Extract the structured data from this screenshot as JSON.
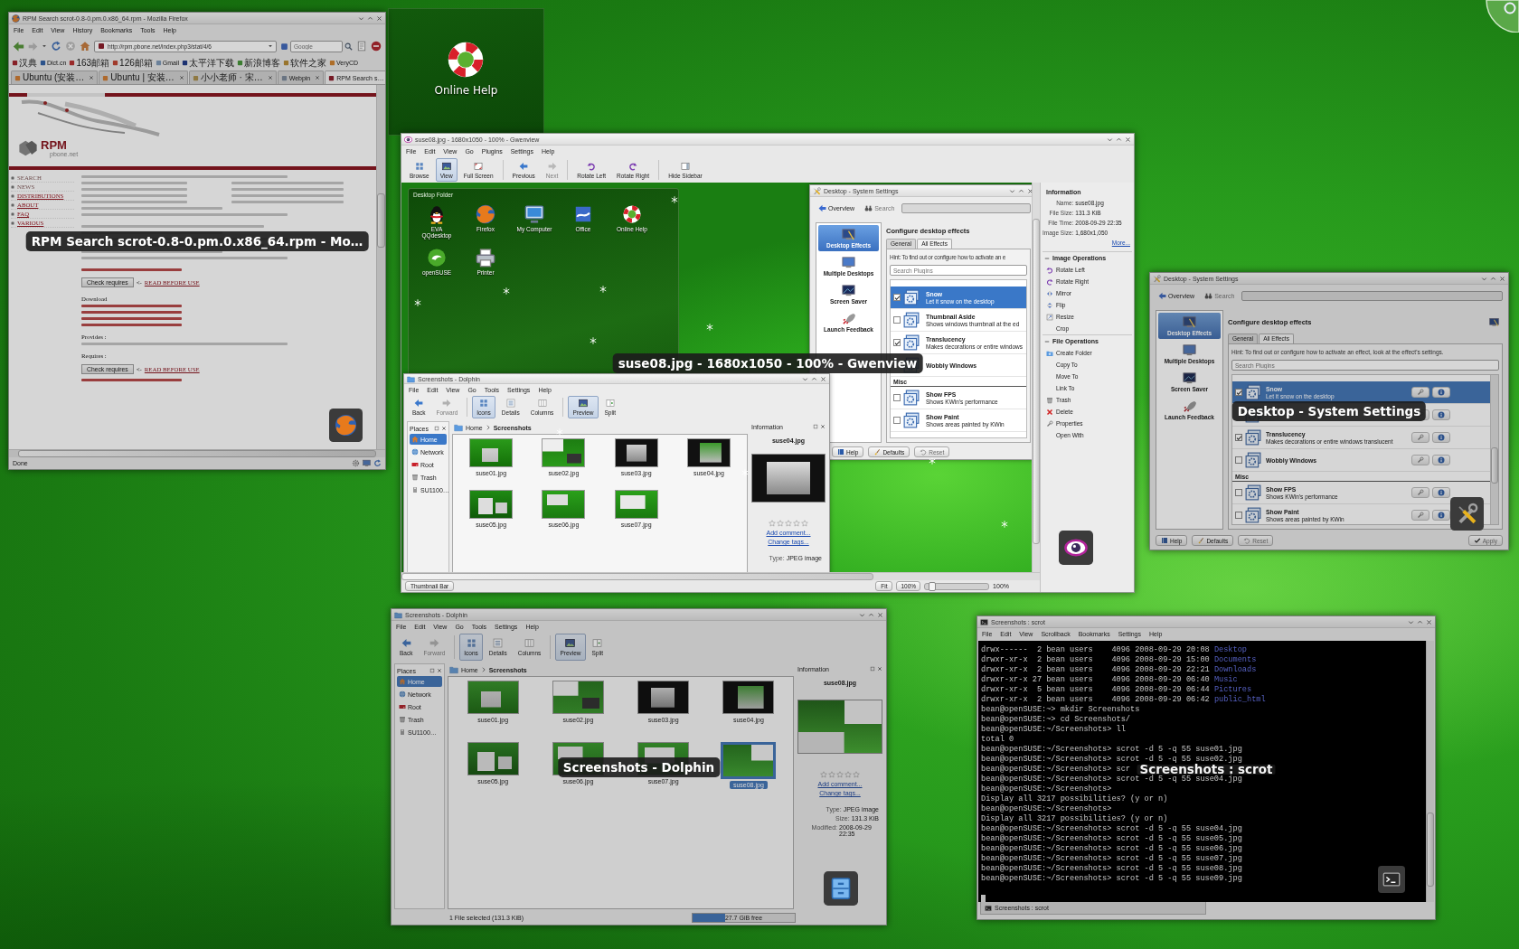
{
  "firefox": {
    "highlighted": false,
    "caption": "RPM Search scrot-0.8-0.pm.0.x86_64.rpm - Mo…",
    "title": "RPM Search scrot-0.8-0.pm.0.x86_64.rpm - Mozilla Firefox",
    "menu": [
      "File",
      "Edit",
      "View",
      "History",
      "Bookmarks",
      "Tools",
      "Help"
    ],
    "url": "http://rpm.pbone.net/index.php3/stat/4/6",
    "search_placeholder": "Google",
    "bookmarks": [
      "汉典",
      "Dict.cn",
      "163邮箱",
      "126邮箱",
      "Gmail",
      "太平洋下载",
      "新浪博客",
      "软件之家",
      "VeryCD"
    ],
    "tabs": [
      {
        "label": "Ubuntu (安装…",
        "selected": false
      },
      {
        "label": "Ubuntu | 安装…",
        "selected": false
      },
      {
        "label": "小小老师 · 宋…",
        "selected": false
      },
      {
        "label": "Webpin",
        "selected": false
      },
      {
        "label": "RPM Search s…",
        "selected": true
      }
    ],
    "page": {
      "logo": "RPM",
      "logo_sub": "pbone.net",
      "site_menu": [
        {
          "label": "SEARCH",
          "link": false
        },
        {
          "label": "NEWS",
          "link": false
        },
        {
          "label": "DISTRIBUTIONS",
          "link": true
        },
        {
          "label": "ABOUT",
          "link": true
        },
        {
          "label": "FAQ",
          "link": true
        },
        {
          "label": "VARIOUS",
          "link": true
        }
      ],
      "blocks": [
        {
          "kind": "line"
        },
        {
          "kind": "pair"
        },
        {
          "kind": "pair"
        },
        {
          "kind": "pair"
        },
        {
          "kind": "pair"
        },
        {
          "kind": "line"
        },
        {
          "kind": "line"
        },
        {
          "kind": "line"
        },
        {
          "kind": "line"
        },
        {
          "kind": "line"
        },
        {
          "kind": "line"
        },
        {
          "kind": "line"
        },
        {
          "kind": "line"
        },
        {
          "kind": "link"
        },
        {
          "kind": "button",
          "label": "Check requires",
          "pointer": "<-",
          "link": "READ BEFORE USE"
        },
        {
          "kind": "heading",
          "text": "Download"
        },
        {
          "kind": "link"
        },
        {
          "kind": "link"
        },
        {
          "kind": "link"
        },
        {
          "kind": "link"
        },
        {
          "kind": "heading",
          "text": "Provides :"
        },
        {
          "kind": "line"
        },
        {
          "kind": "heading",
          "text": "Requires :"
        },
        {
          "kind": "button",
          "label": "Check requires",
          "pointer": "<-",
          "link": "READ BEFORE USE"
        },
        {
          "kind": "link"
        }
      ]
    },
    "status": "Done"
  },
  "desktop": {
    "widget_label": "Online Help"
  },
  "gwenview": {
    "highlighted": true,
    "caption": "suse08.jpg - 1680x1050 - 100% - Gwenview",
    "title": "suse08.jpg - 1680x1050 - 100% - Gwenview",
    "menu": [
      "File",
      "Edit",
      "View",
      "Go",
      "Plugins",
      "Settings",
      "Help"
    ],
    "toolbar": [
      {
        "label": "Browse",
        "selected": false,
        "disabled": false
      },
      {
        "label": "View",
        "selected": true,
        "disabled": false
      },
      {
        "label": "Full Screen",
        "selected": false,
        "disabled": false
      },
      {
        "label": "Previous",
        "selected": false,
        "disabled": false
      },
      {
        "label": "Next",
        "selected": false,
        "disabled": true
      },
      {
        "label": "Rotate Left",
        "selected": false,
        "disabled": false
      },
      {
        "label": "Rotate Right",
        "selected": false,
        "disabled": false
      },
      {
        "label": "Hide Sidebar",
        "selected": false,
        "disabled": false
      }
    ],
    "image": {
      "desktop_folder": {
        "title": "Desktop Folder",
        "icons": [
          "EVA QQdesktop",
          "Firefox",
          "My Computer",
          "Office",
          "Online Help",
          "openSUSE",
          "Printer"
        ]
      },
      "settings": {
        "title": "Desktop - System Settings",
        "overview": "Overview",
        "search_label": "Search",
        "categories": [
          {
            "label": "Desktop Effects",
            "selected": true
          },
          {
            "label": "Multiple Desktops",
            "selected": false
          },
          {
            "label": "Screen Saver",
            "selected": false
          },
          {
            "label": "Launch Feedback",
            "selected": false
          }
        ],
        "heading": "Configure desktop effects",
        "tabs": [
          {
            "label": "General",
            "selected": false
          },
          {
            "label": "All Effects",
            "selected": true
          }
        ],
        "hint": "Hint: To find out or configure how to activate an e",
        "search_placeholder": "Search Plugins",
        "effects": [
          {
            "kind": "effect",
            "title": "Snow",
            "description": "Let it snow on the desktop",
            "checked": true,
            "selected": true
          },
          {
            "kind": "effect",
            "title": "Thumbnail Aside",
            "description": "Shows windows thumbnail at the ed",
            "checked": false,
            "selected": false
          },
          {
            "kind": "effect",
            "title": "Translucency",
            "description": "Makes decorations or entire windows",
            "checked": true,
            "selected": false
          },
          {
            "kind": "effect",
            "title": "Wobbly Windows",
            "selected": false
          },
          {
            "kind": "header",
            "title": "Misc"
          },
          {
            "kind": "effect",
            "title": "Show FPS",
            "description": "Shows KWin's performance",
            "checked": false,
            "selected": false
          },
          {
            "kind": "effect",
            "title": "Show Paint",
            "description": "Shows areas painted by KWin",
            "checked": false,
            "selected": false
          }
        ],
        "buttons": [
          {
            "label": "Help",
            "disabled": false
          },
          {
            "label": "Defaults",
            "disabled": false
          },
          {
            "label": "Reset",
            "disabled": true
          }
        ]
      },
      "dolphin": {
        "title": "Screenshots - Dolphin",
        "menu": [
          "File",
          "Edit",
          "View",
          "Go",
          "Tools",
          "Settings",
          "Help"
        ],
        "toolbar": [
          {
            "label": "Back",
            "selected": false,
            "disabled": false
          },
          {
            "label": "Forward",
            "selected": false,
            "disabled": true
          },
          {
            "label": "Icons",
            "selected": true,
            "disabled": false
          },
          {
            "label": "Details",
            "selected": false,
            "disabled": false
          },
          {
            "label": "Columns",
            "selected": false,
            "disabled": false
          },
          {
            "label": "Preview",
            "selected": true,
            "disabled": false
          },
          {
            "label": "Split",
            "selected": false,
            "disabled": false
          }
        ],
        "places_title": "Places",
        "places": [
          {
            "label": "Home",
            "selected": true
          },
          {
            "label": "Network",
            "selected": false
          },
          {
            "label": "Root",
            "selected": false
          },
          {
            "label": "Trash",
            "selected": false
          },
          {
            "label": "SU1100…",
            "selected": false
          }
        ],
        "breadcrumb": [
          "Home",
          "Screenshots"
        ],
        "files": [
          {
            "name": "suse01.jpg",
            "selected": false
          },
          {
            "name": "suse02.jpg",
            "selected": false
          },
          {
            "name": "suse03.jpg",
            "selected": false
          },
          {
            "name": "suse04.jpg",
            "selected": false
          },
          {
            "name": "suse05.jpg",
            "selected": false
          },
          {
            "name": "suse06.jpg",
            "selected": false
          },
          {
            "name": "suse07.jpg",
            "selected": false
          }
        ],
        "info": {
          "title": "Information",
          "name": "suse04.jpg",
          "stars": 0,
          "add_comment": "Add comment...",
          "change_tags": "Change tags...",
          "fields": [
            {
              "label": "Type:",
              "value": "JPEG image"
            }
          ]
        }
      }
    },
    "sidebar": {
      "information": {
        "title": "Information",
        "fields": [
          {
            "label": "Name:",
            "value": "suse08.jpg"
          },
          {
            "label": "File Size:",
            "value": "131.3 KiB"
          },
          {
            "label": "File Time:",
            "value": "2008-09-29 22:35"
          },
          {
            "label": "Image Size:",
            "value": "1,680x1,050"
          }
        ],
        "more": "More..."
      },
      "groups": [
        {
          "title": "Image Operations",
          "expanded": true,
          "items": [
            "Rotate Left",
            "Rotate Right",
            "Mirror",
            "Flip",
            "Resize",
            "Crop"
          ]
        },
        {
          "title": "File Operations",
          "expanded": true,
          "items": [
            "Create Folder",
            "Copy To",
            "Move To",
            "Link To",
            "Trash",
            "Delete",
            "Properties",
            "Open With"
          ]
        }
      ]
    },
    "statusbar": {
      "thumbnail_bar": "Thumbnail Bar",
      "fit": "Fit",
      "zoom": "100%",
      "level": 0.07,
      "zoom_reading": "100%"
    }
  },
  "system_settings": {
    "highlighted": false,
    "caption": "Desktop - System Settings",
    "title": "Desktop - System Settings",
    "overview": "Overview",
    "search_label": "Search",
    "categories": [
      {
        "label": "Desktop Effects",
        "selected": true
      },
      {
        "label": "Multiple Desktops",
        "selected": false
      },
      {
        "label": "Screen Saver",
        "selected": false
      },
      {
        "label": "Launch Feedback",
        "selected": false
      }
    ],
    "heading": "Configure desktop effects",
    "tabs": [
      {
        "label": "General",
        "selected": false
      },
      {
        "label": "All Effects",
        "selected": true
      }
    ],
    "hint": "Hint: To find out or configure how to activate an effect, look at the effect's settings.",
    "search_placeholder": "Search Plugins",
    "effects": [
      {
        "kind": "effect",
        "title": "Snow",
        "description": "Let it snow on the desktop",
        "checked": true,
        "selected": true
      },
      {
        "kind": "effect",
        "selected": false
      },
      {
        "kind": "effect",
        "title": "Translucency",
        "description": "Makes decorations or entire windows translucent",
        "checked": true,
        "selected": false
      },
      {
        "kind": "effect",
        "title": "Wobbly Windows",
        "checked": false,
        "selected": false
      },
      {
        "kind": "header",
        "title": "Misc"
      },
      {
        "kind": "effect",
        "title": "Show FPS",
        "description": "Shows KWin's performance",
        "checked": false,
        "selected": false
      },
      {
        "kind": "effect",
        "title": "Show Paint",
        "description": "Shows areas painted by KWin",
        "checked": false,
        "selected": false
      }
    ],
    "buttons": [
      {
        "label": "Help",
        "disabled": false
      },
      {
        "label": "Defaults",
        "disabled": false
      },
      {
        "label": "Reset",
        "disabled": true
      }
    ],
    "apply": {
      "label": "Apply",
      "disabled": true
    }
  },
  "dolphin": {
    "highlighted": false,
    "caption": "Screenshots - Dolphin",
    "title": "Screenshots - Dolphin",
    "menu": [
      "File",
      "Edit",
      "View",
      "Go",
      "Tools",
      "Settings",
      "Help"
    ],
    "toolbar": [
      {
        "label": "Back",
        "selected": false,
        "disabled": false
      },
      {
        "label": "Forward",
        "selected": false,
        "disabled": true
      },
      {
        "label": "Icons",
        "selected": true,
        "disabled": false
      },
      {
        "label": "Details",
        "selected": false,
        "disabled": false
      },
      {
        "label": "Columns",
        "selected": false,
        "disabled": false
      },
      {
        "label": "Preview",
        "selected": true,
        "disabled": false
      },
      {
        "label": "Split",
        "selected": false,
        "disabled": false
      }
    ],
    "places_title": "Places",
    "places": [
      {
        "label": "Home",
        "selected": true
      },
      {
        "label": "Network",
        "selected": false
      },
      {
        "label": "Root",
        "selected": false
      },
      {
        "label": "Trash",
        "selected": false
      },
      {
        "label": "SU1100…",
        "selected": false
      }
    ],
    "breadcrumb": [
      "Home",
      "Screenshots"
    ],
    "files": [
      {
        "name": "suse01.jpg",
        "selected": false
      },
      {
        "name": "suse02.jpg",
        "selected": false
      },
      {
        "name": "suse03.jpg",
        "selected": false
      },
      {
        "name": "suse04.jpg",
        "selected": false
      },
      {
        "name": "suse05.jpg",
        "selected": false
      },
      {
        "name": "suse06.jpg",
        "selected": false
      },
      {
        "name": "suse07.jpg",
        "selected": false
      },
      {
        "name": "suse08.jpg",
        "selected": true
      }
    ],
    "info": {
      "title": "Information",
      "name": "suse08.jpg",
      "stars": 0,
      "add_comment": "Add comment...",
      "change_tags": "Change tags...",
      "fields": [
        {
          "label": "Type:",
          "value": "JPEG image"
        },
        {
          "label": "Size:",
          "value": "131.3 KiB"
        },
        {
          "label": "Modified:",
          "value": "2008-09-29 22:35"
        }
      ]
    },
    "status": "1 File selected (131.3 KiB)",
    "free_space": {
      "reading": "27.7 GiB free",
      "level": 0.32
    }
  },
  "konsole": {
    "highlighted": false,
    "caption": "Screenshots : scrot",
    "title": "Screenshots : scrot",
    "menu": [
      "File",
      "Edit",
      "View",
      "Scrollback",
      "Bookmarks",
      "Settings",
      "Help"
    ],
    "lines": [
      {
        "text": "drwx------  2 bean users    4096 2008-09-29 20:08",
        "dir": "Desktop"
      },
      {
        "text": "drwxr-xr-x  2 bean users    4096 2008-09-29 15:00",
        "dir": "Documents"
      },
      {
        "text": "drwxr-xr-x  2 bean users    4096 2008-09-29 22:21",
        "dir": "Downloads"
      },
      {
        "text": "drwxr-xr-x 27 bean users    4096 2008-09-29 06:40",
        "dir": "Music"
      },
      {
        "text": "drwxr-xr-x  5 bean users    4096 2008-09-29 06:44",
        "dir": "Pictures"
      },
      {
        "text": "drwxr-xr-x  2 bean users    4096 2008-09-29 06:42",
        "dir": "public_html"
      },
      {
        "text": "bean@openSUSE:~> mkdir Screenshots"
      },
      {
        "text": "bean@openSUSE:~> cd Screenshots/"
      },
      {
        "text": "bean@openSUSE:~/Screenshots> ll"
      },
      {
        "text": "total 0"
      },
      {
        "text": "bean@openSUSE:~/Screenshots> scrot -d 5 -q 55 suse01.jpg"
      },
      {
        "text": "bean@openSUSE:~/Screenshots> scrot -d 5 -q 55 suse02.jpg"
      },
      {
        "text": "bean@openSUSE:~/Screenshots> scr"
      },
      {
        "text": "bean@openSUSE:~/Screenshots> scrot -d 5 -q 55 suse04.jpg"
      },
      {
        "text": "bean@openSUSE:~/Screenshots>"
      },
      {
        "text": "Display all 3217 possibilities? (y or n)"
      },
      {
        "text": "bean@openSUSE:~/Screenshots>"
      },
      {
        "text": "Display all 3217 possibilities? (y or n)"
      },
      {
        "text": "bean@openSUSE:~/Screenshots> scrot -d 5 -q 55 suse04.jpg"
      },
      {
        "text": "bean@openSUSE:~/Screenshots> scrot -d 5 -q 55 suse05.jpg"
      },
      {
        "text": "bean@openSUSE:~/Screenshots> scrot -d 5 -q 55 suse06.jpg"
      },
      {
        "text": "bean@openSUSE:~/Screenshots> scrot -d 5 -q 55 suse07.jpg"
      },
      {
        "text": "bean@openSUSE:~/Screenshots> scrot -d 5 -q 55 suse08.jpg"
      },
      {
        "text": "bean@openSUSE:~/Screenshots> scrot -d 5 -q 55 suse09.jpg"
      }
    ],
    "tab": "Screenshots : scrot"
  }
}
